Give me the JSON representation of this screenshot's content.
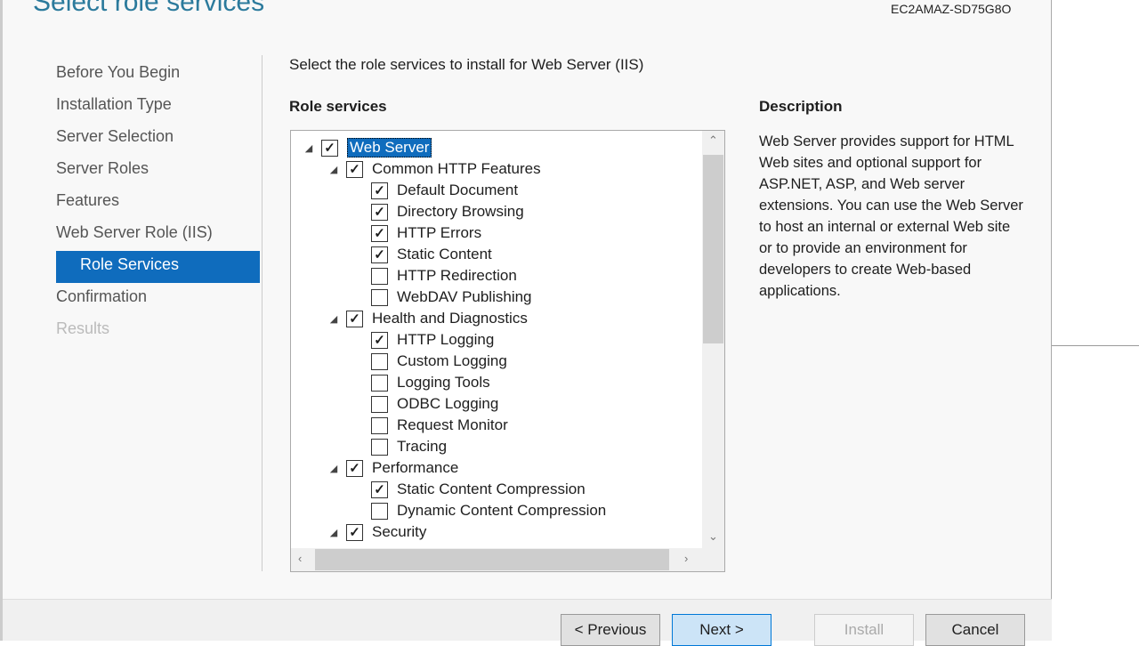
{
  "header": {
    "title": "Select role services",
    "server": "EC2AMAZ-SD75G8O"
  },
  "nav": [
    {
      "label": "Before You Begin",
      "state": "normal"
    },
    {
      "label": "Installation Type",
      "state": "normal"
    },
    {
      "label": "Server Selection",
      "state": "normal"
    },
    {
      "label": "Server Roles",
      "state": "normal"
    },
    {
      "label": "Features",
      "state": "normal"
    },
    {
      "label": "Web Server Role (IIS)",
      "state": "normal"
    },
    {
      "label": "Role Services",
      "state": "active"
    },
    {
      "label": "Confirmation",
      "state": "normal"
    },
    {
      "label": "Results",
      "state": "disabled"
    }
  ],
  "main": {
    "instruction": "Select the role services to install for Web Server (IIS)",
    "role_services_label": "Role services",
    "description_label": "Description",
    "description": "Web Server provides support for HTML Web sites and optional support for ASP.NET, ASP, and Web server extensions. You can use the Web Server to host an internal or external Web site or to provide an environment for developers to create Web-based applications."
  },
  "tree": [
    {
      "label": "Web Server",
      "level": 0,
      "checked": true,
      "expander": true,
      "selected": true
    },
    {
      "label": "Common HTTP Features",
      "level": 1,
      "checked": true,
      "expander": true
    },
    {
      "label": "Default Document",
      "level": 2,
      "checked": true
    },
    {
      "label": "Directory Browsing",
      "level": 2,
      "checked": true
    },
    {
      "label": "HTTP Errors",
      "level": 2,
      "checked": true
    },
    {
      "label": "Static Content",
      "level": 2,
      "checked": true
    },
    {
      "label": "HTTP Redirection",
      "level": 2,
      "checked": false
    },
    {
      "label": "WebDAV Publishing",
      "level": 2,
      "checked": false
    },
    {
      "label": "Health and Diagnostics",
      "level": 1,
      "checked": true,
      "expander": true
    },
    {
      "label": "HTTP Logging",
      "level": 2,
      "checked": true
    },
    {
      "label": "Custom Logging",
      "level": 2,
      "checked": false
    },
    {
      "label": "Logging Tools",
      "level": 2,
      "checked": false
    },
    {
      "label": "ODBC Logging",
      "level": 2,
      "checked": false
    },
    {
      "label": "Request Monitor",
      "level": 2,
      "checked": false
    },
    {
      "label": "Tracing",
      "level": 2,
      "checked": false
    },
    {
      "label": "Performance",
      "level": 1,
      "checked": true,
      "expander": true
    },
    {
      "label": "Static Content Compression",
      "level": 2,
      "checked": true
    },
    {
      "label": "Dynamic Content Compression",
      "level": 2,
      "checked": false
    },
    {
      "label": "Security",
      "level": 1,
      "checked": true,
      "expander": true
    }
  ],
  "buttons": {
    "previous": "< Previous",
    "next": "Next >",
    "install": "Install",
    "cancel": "Cancel"
  }
}
